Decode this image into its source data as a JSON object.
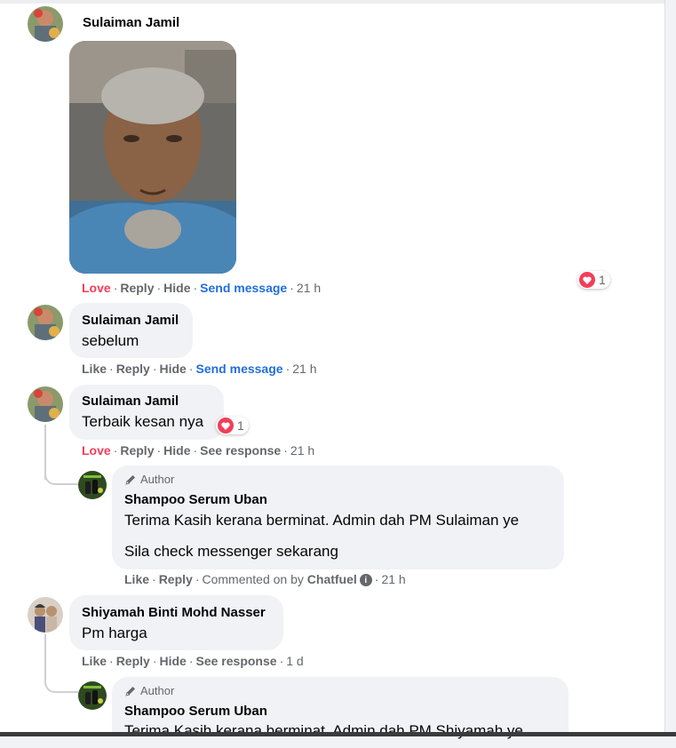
{
  "comments": [
    {
      "author": "Sulaiman Jamil",
      "actions": {
        "react": "Love",
        "reply": "Reply",
        "hide": "Hide",
        "extra": "Send message",
        "time": "21 h"
      },
      "reaction_count": "1"
    },
    {
      "author": "Sulaiman Jamil",
      "text": "sebelum",
      "actions": {
        "react": "Like",
        "reply": "Reply",
        "hide": "Hide",
        "extra": "Send message",
        "time": "21 h"
      }
    },
    {
      "author": "Sulaiman Jamil",
      "text": "Terbaik kesan nya",
      "reaction_count": "1",
      "actions": {
        "react": "Love",
        "reply": "Reply",
        "hide": "Hide",
        "extra": "See response",
        "time": "21 h"
      }
    },
    {
      "author": "Shiyamah Binti Mohd Nasser",
      "text": "Pm harga",
      "actions": {
        "react": "Like",
        "reply": "Reply",
        "hide": "Hide",
        "extra": "See response",
        "time": "1 d"
      }
    }
  ],
  "replies": [
    {
      "badge": "Author",
      "author": "Shampoo Serum Uban",
      "line1": "Terima Kasih kerana berminat. Admin dah PM Sulaiman ye",
      "line2": "Sila check messenger sekarang",
      "actions": {
        "react": "Like",
        "reply": "Reply",
        "commented": "Commented on by",
        "app": "Chatfuel",
        "time": "21 h"
      }
    },
    {
      "badge": "Author",
      "author": "Shampoo Serum Uban",
      "line1": "Terima Kasih kerana berminat. Admin dah PM Shiyamah ye"
    }
  ],
  "separator": "·",
  "colors": {
    "love": "#f33e58",
    "link": "#216fdb",
    "meta": "#65676b",
    "bubble": "#f0f2f5"
  }
}
